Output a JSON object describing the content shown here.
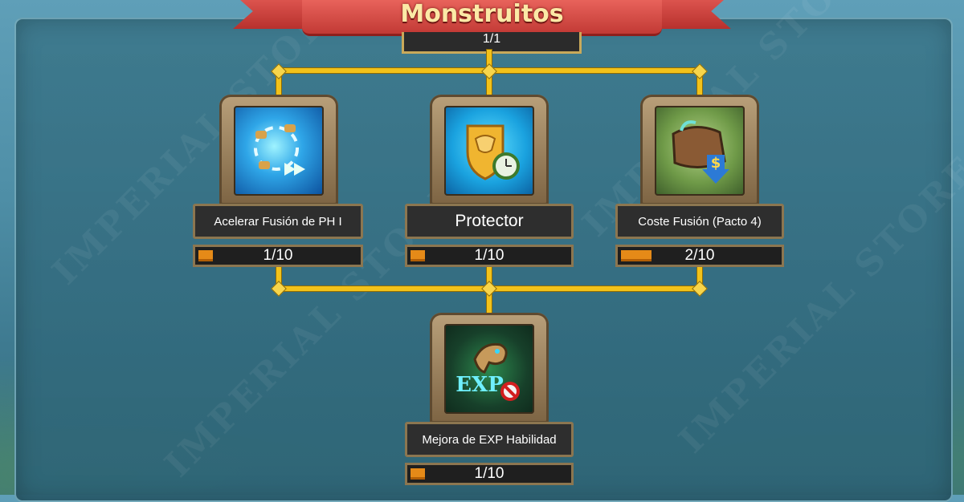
{
  "header": {
    "title": "Monstruitos",
    "prev_level": "1/1"
  },
  "watermark": "IMPERIAL STORE",
  "colors": {
    "connector": "#f2c21a",
    "progress_fill": "#e58a18",
    "ribbon": "#c23a35",
    "title_text": "#fbe9a6"
  },
  "nodes": [
    {
      "label": "Acelerar Fusión de PH I",
      "level": "1/10",
      "progress": 0.1,
      "icon": "accelerate-fusion-icon"
    },
    {
      "label": "Protector",
      "level": "1/10",
      "progress": 0.1,
      "icon": "protector-shield-icon"
    },
    {
      "label": "Coste Fusión (Pacto 4)",
      "level": "2/10",
      "progress": 0.2,
      "icon": "fusion-cost-icon"
    },
    {
      "label": "Mejora de EXP Habilidad",
      "level": "1/10",
      "progress": 0.1,
      "icon": "exp-skill-icon"
    }
  ]
}
